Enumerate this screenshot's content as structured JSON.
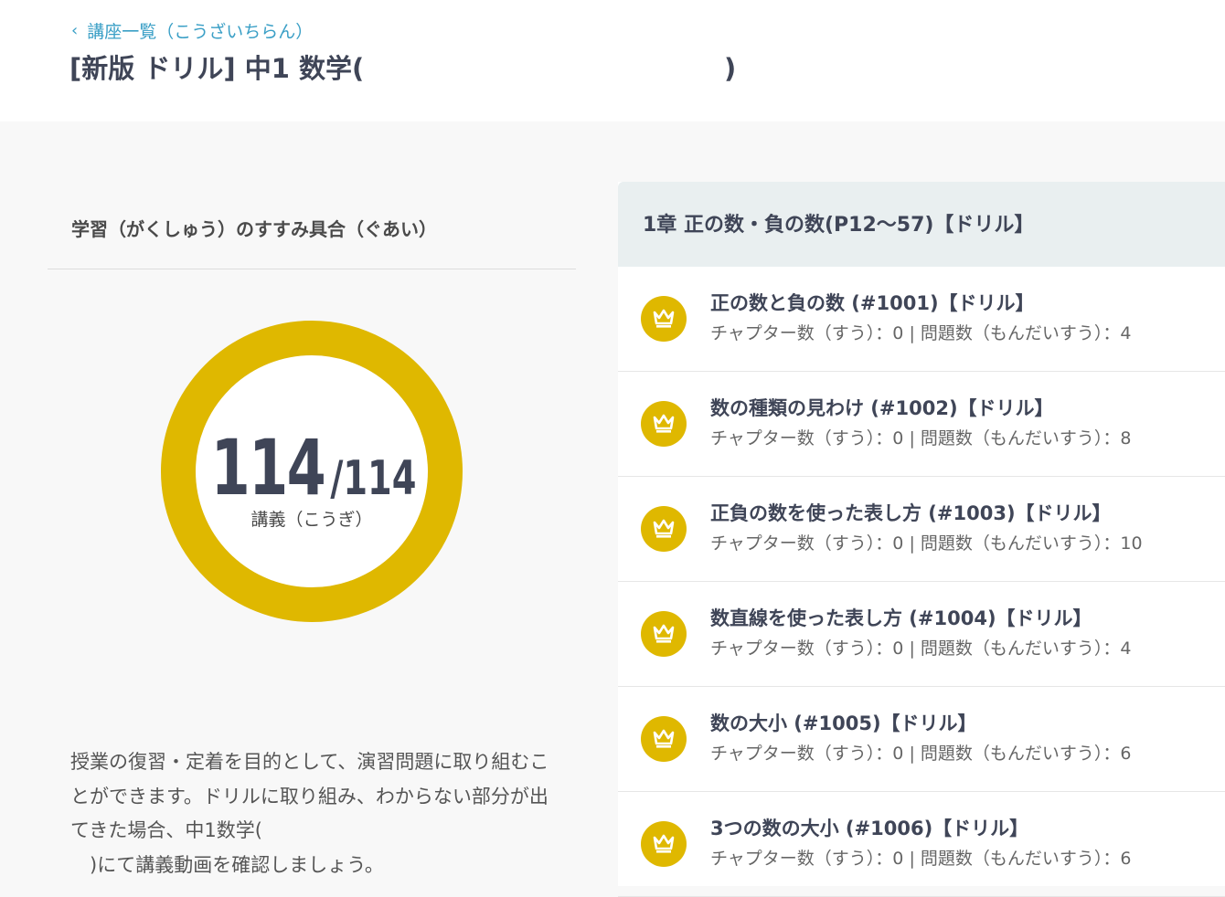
{
  "header": {
    "back_label": "講座一覧（こうざいちらん）",
    "title": "[新版 ドリル] 中1 数学(                                       )"
  },
  "progress": {
    "heading": "学習（がくしゅう）のすすみ具合（ぐあい）",
    "completed": "114",
    "total": "/114",
    "completed_fraction": 1.0,
    "unit": "講義（こうぎ）",
    "ring_color": "#dfb800"
  },
  "description": "授業の復習・定着を目的として、演習問題に取り組むことができます。ドリルに取り組み、わからない部分が出てきた場合、中1数学(\n　)にて講義動画を確認しましょう。",
  "chapter": {
    "title": "1章 正の数・負の数(P12〜57)【ドリル】",
    "lessons": [
      {
        "title": "正の数と負の数 (#1001)【ドリル】",
        "meta": "チャプター数（すう）：0 | 問題数（もんだいすう）：4",
        "icon": "crown-icon"
      },
      {
        "title": "数の種類の見わけ (#1002)【ドリル】",
        "meta": "チャプター数（すう）：0 | 問題数（もんだいすう）：8",
        "icon": "crown-icon"
      },
      {
        "title": "正負の数を使った表し方 (#1003)【ドリル】",
        "meta": "チャプター数（すう）：0 | 問題数（もんだいすう）：10",
        "icon": "crown-icon"
      },
      {
        "title": "数直線を使った表し方 (#1004)【ドリル】",
        "meta": "チャプター数（すう）：0 | 問題数（もんだいすう）：4",
        "icon": "crown-icon"
      },
      {
        "title": "数の大小 (#1005)【ドリル】",
        "meta": "チャプター数（すう）：0 | 問題数（もんだいすう）：6",
        "icon": "crown-icon"
      },
      {
        "title": "3つの数の大小 (#1006)【ドリル】",
        "meta": "チャプター数（すう）：0 | 問題数（もんだいすう）：6",
        "icon": "crown-icon"
      }
    ]
  },
  "colors": {
    "accent": "#dfb800",
    "link": "#3a9fc6",
    "chapter_header_bg": "#e9eff0"
  }
}
